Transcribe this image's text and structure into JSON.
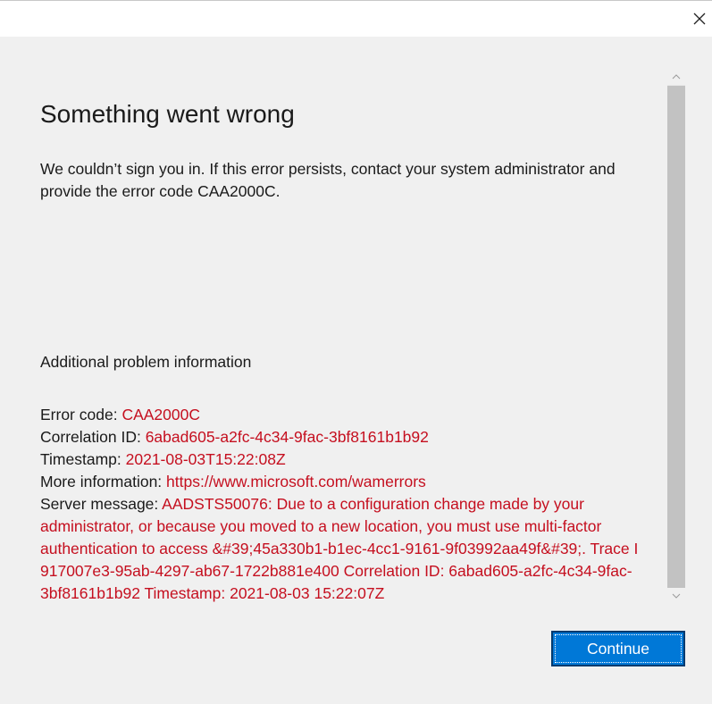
{
  "dialog": {
    "heading": "Something went wrong",
    "intro": "We couldn’t sign you in. If this error persists, contact your system administrator and provide the error code CAA2000C.",
    "additional_heading": "Additional problem information"
  },
  "details": {
    "error_code_label": "Error code: ",
    "error_code_value": "CAA2000C",
    "correlation_label": "Correlation ID: ",
    "correlation_value": "6abad605-a2fc-4c34-9fac-3bf8161b1b92",
    "timestamp_label": "Timestamp: ",
    "timestamp_value": "2021-08-03T15:22:08Z",
    "more_info_label": "More information: ",
    "more_info_value": "https://www.microsoft.com/wamerrors",
    "server_label": "Server message: ",
    "server_lines": [
      "AADSTS50076: Due to a configuration change made by your",
      "administrator, or because you moved to a new location, you must use multi-factor",
      "authentication to access &#39;45a330b1-b1ec-4cc1-9161-9f03992aa49f&#39;. Trace I",
      "917007e3-95ab-4297-ab67-1722b881e400 Correlation ID: 6abad605-a2fc-4c34-9fac-",
      "3bf8161b1b92 Timestamp: 2021-08-03 15:22:07Z"
    ]
  },
  "buttons": {
    "continue": "Continue"
  },
  "icons": {
    "close": "close-icon",
    "scroll_up": "chevron-up-icon",
    "scroll_down": "chevron-down-icon"
  },
  "colors": {
    "accent": "#0078d7",
    "error_text": "#c50f1f"
  }
}
